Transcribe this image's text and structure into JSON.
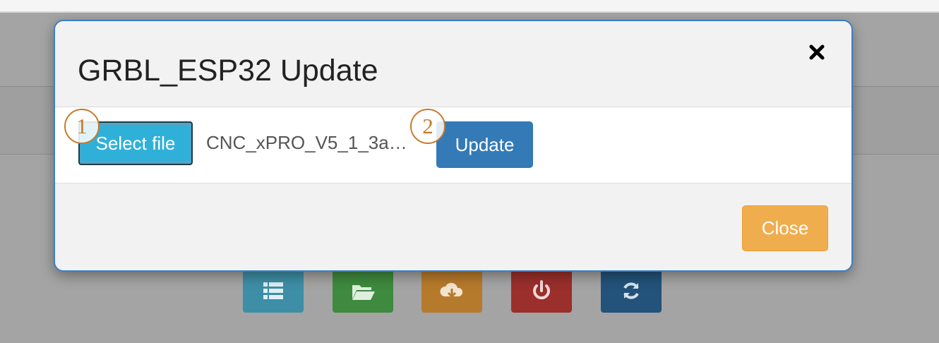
{
  "modal": {
    "title": "GRBL_ESP32 Update",
    "close_icon": "close-icon"
  },
  "body": {
    "select_file_label": "Select file",
    "file_name": "CNC_xPRO_V5_1_3a…",
    "update_label": "Update"
  },
  "footer": {
    "close_label": "Close"
  },
  "markers": {
    "step1": "1",
    "step2": "2"
  },
  "background_toolbar": {
    "icons": [
      "list-icon",
      "folder-open-icon",
      "cloud-download-icon",
      "power-icon",
      "refresh-icon"
    ],
    "colors": [
      "#3d8ea6",
      "#3e8a3e",
      "#b67a2c",
      "#9a2f2c",
      "#23527a"
    ]
  },
  "colors": {
    "select_button": "#2fb0d8",
    "update_button": "#337ab7",
    "close_button": "#f0ad4e",
    "modal_border": "#3b7fc4",
    "annotation": "#c8792a"
  }
}
